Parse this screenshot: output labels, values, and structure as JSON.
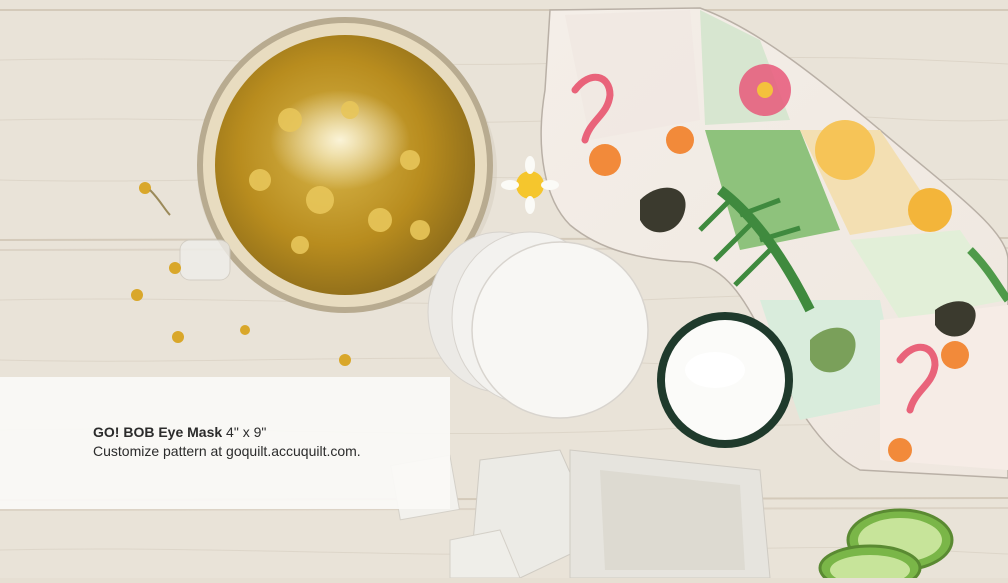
{
  "caption": {
    "title": "GO! BOB Eye Mask",
    "size": " 4\" x 9\"",
    "subtitle": "Customize pattern at goquilt.accuquilt.com."
  },
  "colors": {
    "wood": "#e8e1d5",
    "tea": "#c9a22e",
    "mask_pink": "#e9637a",
    "mask_green": "#4f9a4a",
    "cream": "#f7f6f2",
    "jar": "#1f3a2c",
    "caption_panel": "#faf9f6"
  },
  "image": {
    "objects": [
      "tea-cup-icon",
      "chamomile-flower-icon",
      "eye-mask-icon",
      "cotton-pad-icon",
      "cream-jar-icon",
      "tea-bag-icon",
      "cucumber-icon"
    ]
  }
}
